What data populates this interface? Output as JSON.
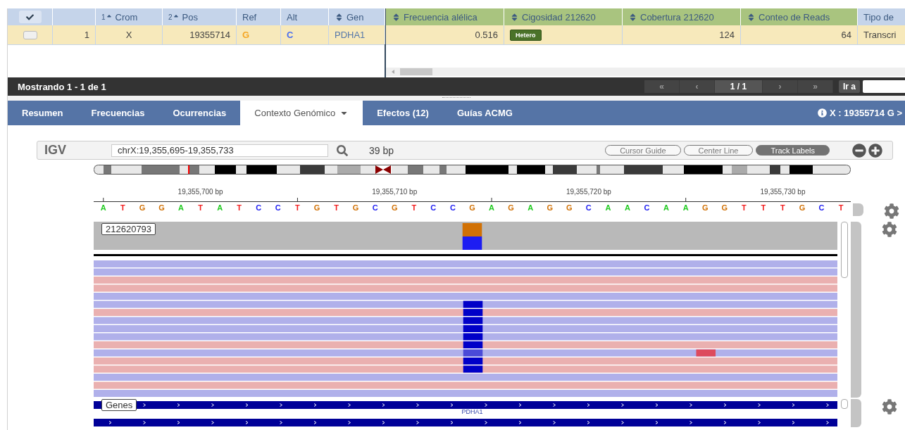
{
  "table": {
    "frozen_columns": [
      {
        "kind": "select"
      },
      {
        "kind": "plain"
      },
      {
        "label": "Crom",
        "kind": "sorted",
        "order": "1"
      },
      {
        "label": "Pos",
        "kind": "sorted",
        "order": "2"
      },
      {
        "label": "Ref",
        "kind": "plain"
      },
      {
        "label": "Alt",
        "kind": "plain"
      },
      {
        "label": "Gen",
        "kind": "sortable"
      }
    ],
    "columns": [
      {
        "label": "Frecuencia alélica",
        "kind": "sortable",
        "color": "#a9c47f"
      },
      {
        "label": "Cigosidad 212620",
        "kind": "sortable",
        "color": "#a9c47f"
      },
      {
        "label": "Cobertura 212620",
        "kind": "sortable",
        "color": "#a9c47f"
      },
      {
        "label": "Conteo de Reads",
        "kind": "sortable",
        "color": "#a9c47f"
      },
      {
        "label": "Tipo de",
        "kind": "plain",
        "color": "#c5d4ea"
      }
    ],
    "rows": [
      {
        "checked": false,
        "frozen_cells": [
          {
            "text": "1",
            "kind": "number"
          },
          {
            "text": "X",
            "kind": "center"
          },
          {
            "text": "19355714",
            "kind": "number"
          },
          {
            "text": "G",
            "kind": "base",
            "color": "#f5a623"
          },
          {
            "text": "C",
            "kind": "base",
            "color": "#4a6ef0"
          },
          {
            "text": "PDHA1",
            "kind": "link"
          }
        ],
        "cells": [
          {
            "text": "0.516",
            "kind": "number"
          },
          {
            "text": "Hetero",
            "kind": "badge"
          },
          {
            "text": "124",
            "kind": "number"
          },
          {
            "text": "64",
            "kind": "number"
          },
          {
            "text": "Transcri",
            "kind": "text"
          }
        ]
      }
    ]
  },
  "footer": {
    "status": "Mostrando 1 - 1 de 1",
    "pager": [
      {
        "label": "«",
        "kind": "nav"
      },
      {
        "label": "‹",
        "kind": "nav"
      },
      {
        "label": "1 / 1",
        "kind": "page"
      },
      {
        "label": "›",
        "kind": "nav"
      },
      {
        "label": "»",
        "kind": "nav"
      }
    ],
    "goto_label": "Ir a"
  },
  "tabs": [
    {
      "label": "Resumen",
      "selected": false,
      "dropdown": false
    },
    {
      "label": "Frecuencias",
      "selected": false,
      "dropdown": false
    },
    {
      "label": "Ocurrencias",
      "selected": false,
      "dropdown": false
    },
    {
      "label": "Contexto Genómico",
      "selected": true,
      "dropdown": true
    },
    {
      "label": "Efectos (12)",
      "selected": false,
      "dropdown": false
    },
    {
      "label": "Guías ACMG",
      "selected": false,
      "dropdown": false
    }
  ],
  "variant_info": "X : 19355714 G >",
  "igv": {
    "logo": "IGV",
    "locus": "chrX:19,355,695-19,355,733",
    "span": "39 bp",
    "toggles": [
      {
        "label": "Cursor Guide",
        "selected": false
      },
      {
        "label": "Center Line",
        "selected": false
      },
      {
        "label": "Track Labels",
        "selected": true
      }
    ],
    "ruler": [
      "19,355,700 bp",
      "19,355,710 bp",
      "19,355,720 bp",
      "19,355,730 bp"
    ],
    "sequence": [
      {
        "base": "A",
        "color": "#1fc91f"
      },
      {
        "base": "T",
        "color": "#f21d1d"
      },
      {
        "base": "G",
        "color": "#d17105"
      },
      {
        "base": "G",
        "color": "#d17105"
      },
      {
        "base": "A",
        "color": "#1fc91f"
      },
      {
        "base": "T",
        "color": "#f21d1d"
      },
      {
        "base": "A",
        "color": "#1fc91f"
      },
      {
        "base": "T",
        "color": "#f21d1d"
      },
      {
        "base": "C",
        "color": "#1d1df2"
      },
      {
        "base": "C",
        "color": "#1d1df2"
      },
      {
        "base": "T",
        "color": "#f21d1d"
      },
      {
        "base": "G",
        "color": "#d17105"
      },
      {
        "base": "T",
        "color": "#f21d1d"
      },
      {
        "base": "G",
        "color": "#d17105"
      },
      {
        "base": "C",
        "color": "#1d1df2"
      },
      {
        "base": "G",
        "color": "#d17105"
      },
      {
        "base": "T",
        "color": "#f21d1d"
      },
      {
        "base": "C",
        "color": "#1d1df2"
      },
      {
        "base": "C",
        "color": "#1d1df2"
      },
      {
        "base": "G",
        "color": "#d17105"
      },
      {
        "base": "A",
        "color": "#1fc91f"
      },
      {
        "base": "G",
        "color": "#d17105"
      },
      {
        "base": "A",
        "color": "#1fc91f"
      },
      {
        "base": "G",
        "color": "#d17105"
      },
      {
        "base": "G",
        "color": "#d17105"
      },
      {
        "base": "C",
        "color": "#1d1df2"
      },
      {
        "base": "A",
        "color": "#1fc91f"
      },
      {
        "base": "A",
        "color": "#1fc91f"
      },
      {
        "base": "C",
        "color": "#1d1df2"
      },
      {
        "base": "A",
        "color": "#1fc91f"
      },
      {
        "base": "A",
        "color": "#1fc91f"
      },
      {
        "base": "G",
        "color": "#d17105"
      },
      {
        "base": "G",
        "color": "#d17105"
      },
      {
        "base": "T",
        "color": "#f21d1d"
      },
      {
        "base": "T",
        "color": "#f21d1d"
      },
      {
        "base": "T",
        "color": "#f21d1d"
      },
      {
        "base": "G",
        "color": "#d17105"
      },
      {
        "base": "C",
        "color": "#1d1df2"
      },
      {
        "base": "T",
        "color": "#f21d1d"
      }
    ],
    "coverage_label": "212620793",
    "reads": [
      {
        "kind": "forward",
        "mismatch": false
      },
      {
        "kind": "forward",
        "mismatch": false
      },
      {
        "kind": "reverse",
        "mismatch": false
      },
      {
        "kind": "reverse",
        "mismatch": false
      },
      {
        "kind": "forward",
        "mismatch": false
      },
      {
        "kind": "forward",
        "mismatch": true
      },
      {
        "kind": "reverse",
        "mismatch": true
      },
      {
        "kind": "forward",
        "mismatch": true
      },
      {
        "kind": "forward",
        "mismatch": true
      },
      {
        "kind": "forward",
        "mismatch": true
      },
      {
        "kind": "reverse",
        "mismatch": true
      },
      {
        "kind": "noisy",
        "mismatch": true
      },
      {
        "kind": "reverse",
        "mismatch": true
      },
      {
        "kind": "reverse",
        "mismatch": true
      },
      {
        "kind": "forward",
        "mismatch": false
      },
      {
        "kind": "reverse",
        "mismatch": false
      },
      {
        "kind": "forward",
        "mismatch": false
      }
    ],
    "genes_label": "Genes",
    "gene": "PDHA1"
  }
}
